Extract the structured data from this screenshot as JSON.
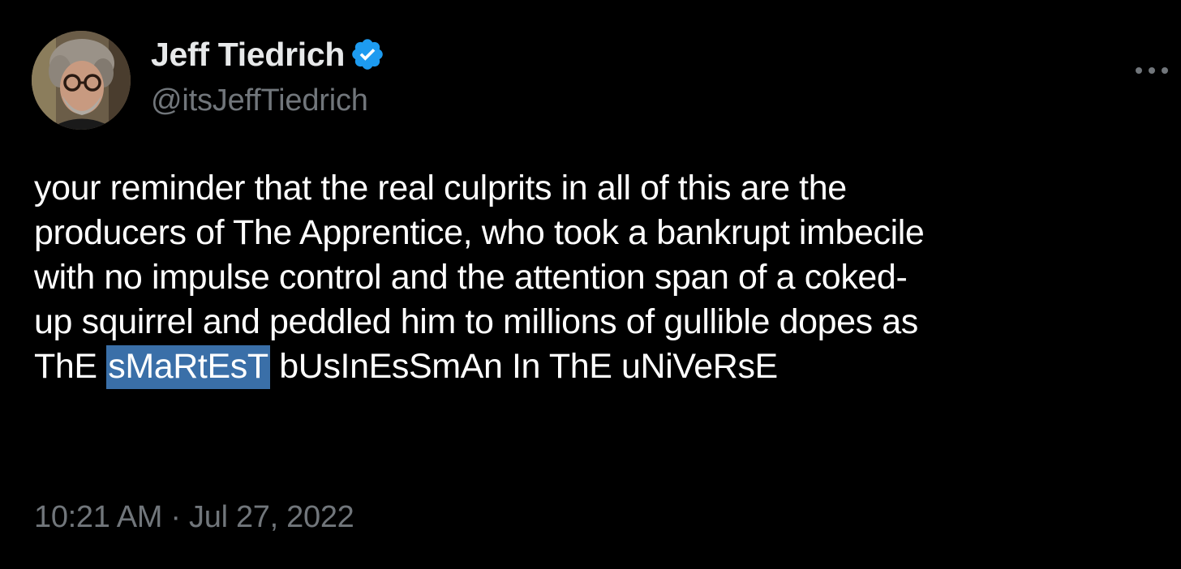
{
  "author": {
    "display_name": "Jeff Tiedrich",
    "handle": "@itsJeffTiedrich",
    "verified": true,
    "verified_color": "#1d9bf0"
  },
  "tweet": {
    "lines": [
      "your reminder that the real culprits in all of this are the",
      "producers of The Apprentice, who took a bankrupt imbecile",
      "with no impulse control and the attention span of a coked-",
      "up squirrel and peddled him to millions of gullible dopes as"
    ],
    "last_line": {
      "before": "ThE ",
      "highlighted": "sMaRtEsT",
      "after": " bUsInEsSmAn In ThE uNiVeRsE"
    },
    "highlight_color": "#3a6fa8"
  },
  "meta": {
    "time": "10:21 AM",
    "separator": " · ",
    "date": "Jul 27, 2022"
  },
  "icons": {
    "more": "more-options-icon",
    "verified": "verified-badge-icon"
  }
}
